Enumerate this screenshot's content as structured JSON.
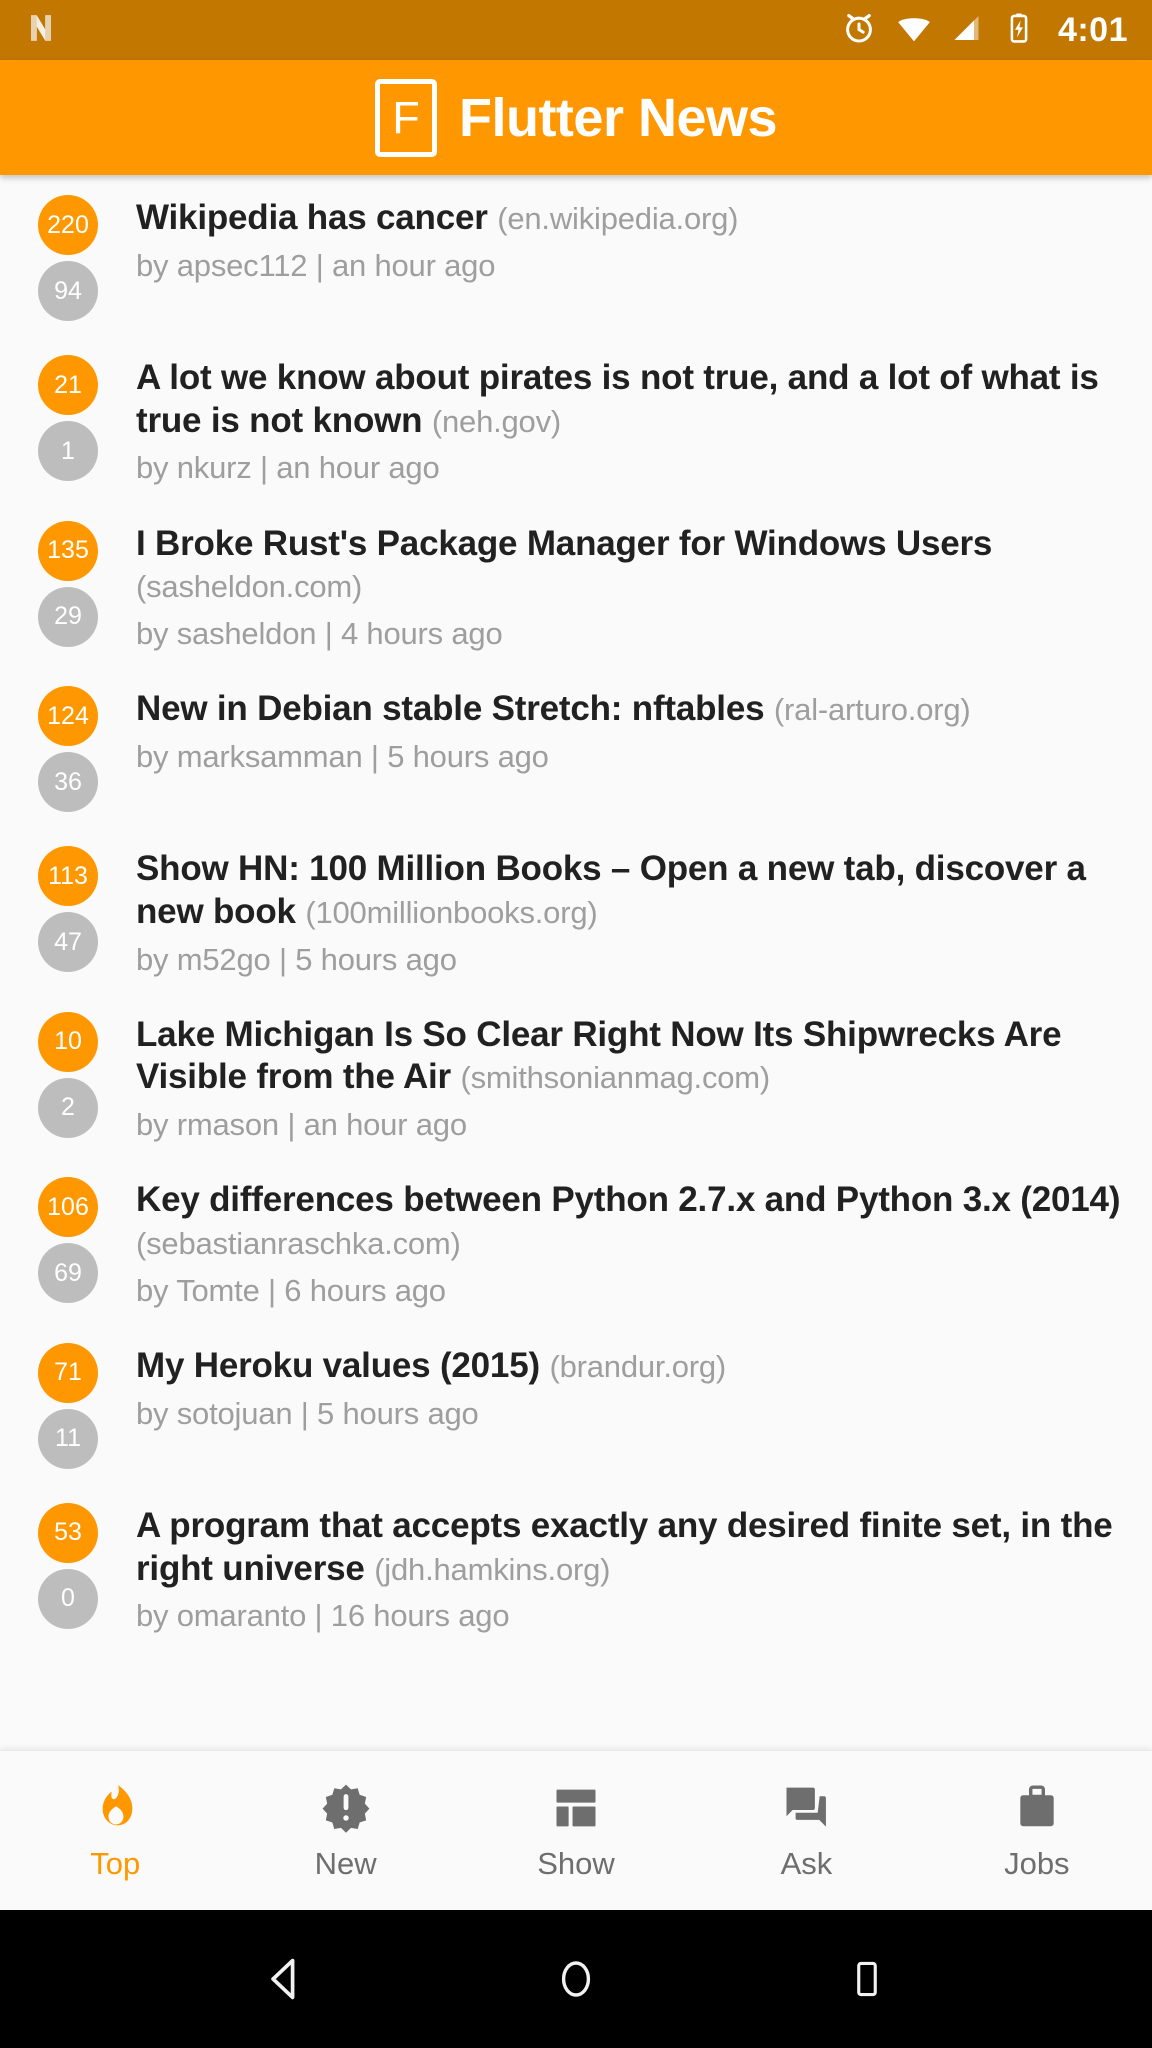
{
  "status_bar": {
    "app_icon": "n-netflix-icon",
    "icons": [
      "alarm-icon",
      "wifi-icon",
      "cell-signal-icon",
      "battery-charging-icon"
    ],
    "time": "4:01",
    "background_color": "#c27700"
  },
  "app_bar": {
    "logo_letter": "F",
    "title": "Flutter News",
    "background_color": "#ff9800"
  },
  "colors": {
    "accent": "#ff9800",
    "score_badge": "#ff9800",
    "comment_badge": "#bdbdbd",
    "title_text": "#212121",
    "meta_text": "#9e9e9e",
    "page_background": "#fafafa"
  },
  "news": [
    {
      "score": "220",
      "comments": "94",
      "title": "Wikipedia has cancer",
      "domain": "(en.wikipedia.org)",
      "meta": "by apsec112 | an hour ago"
    },
    {
      "score": "21",
      "comments": "1",
      "title": "A lot we know about pirates is not true, and a lot of what is true is not known",
      "domain": "(neh.gov)",
      "meta": "by nkurz | an hour ago"
    },
    {
      "score": "135",
      "comments": "29",
      "title": "I Broke Rust's Package Manager for Windows Users",
      "domain": "(sasheldon.com)",
      "meta": "by sasheldon | 4 hours ago"
    },
    {
      "score": "124",
      "comments": "36",
      "title": "New in Debian stable Stretch: nftables",
      "domain": "(ral-arturo.org)",
      "meta": "by marksamman | 5 hours ago"
    },
    {
      "score": "113",
      "comments": "47",
      "title": "Show HN: 100 Million Books – Open a new tab, discover a new book",
      "domain": "(100millionbooks.org)",
      "meta": "by m52go | 5 hours ago"
    },
    {
      "score": "10",
      "comments": "2",
      "title": "Lake Michigan Is So Clear Right Now Its Shipwrecks Are Visible from the Air",
      "domain": "(smithsonianmag.com)",
      "meta": "by rmason | an hour ago"
    },
    {
      "score": "106",
      "comments": "69",
      "title": "Key differences between Python 2.7.x and Python 3.x (2014)",
      "domain": "(sebastianraschka.com)",
      "meta": "by Tomte | 6 hours ago"
    },
    {
      "score": "71",
      "comments": "11",
      "title": "My Heroku values (2015)",
      "domain": "(brandur.org)",
      "meta": "by sotojuan | 5 hours ago"
    },
    {
      "score": "53",
      "comments": "0",
      "title": "A program that accepts exactly any desired finite set, in the right universe",
      "domain": "(jdh.hamkins.org)",
      "meta": "by omaranto | 16 hours ago"
    }
  ],
  "bottom_nav": {
    "active_index": 0,
    "items": [
      {
        "label": "Top",
        "icon": "flame-icon"
      },
      {
        "label": "New",
        "icon": "new-releases-icon"
      },
      {
        "label": "Show",
        "icon": "dashboard-icon"
      },
      {
        "label": "Ask",
        "icon": "question-answer-icon"
      },
      {
        "label": "Jobs",
        "icon": "briefcase-icon"
      }
    ]
  },
  "system_nav": {
    "back": "back-triangle-icon",
    "home": "home-circle-icon",
    "recents": "recents-square-icon"
  }
}
